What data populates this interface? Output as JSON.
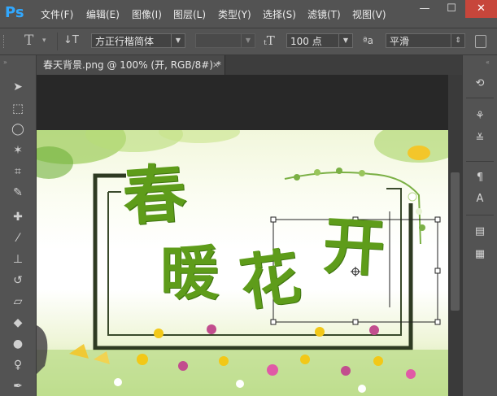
{
  "app": {
    "logo": "Ps"
  },
  "menu": [
    "文件(F)",
    "编辑(E)",
    "图像(I)",
    "图层(L)",
    "类型(Y)",
    "选择(S)",
    "滤镜(T)",
    "视图(V)"
  ],
  "window_controls": {
    "minimize": "—",
    "maximize": "☐",
    "close": "✕"
  },
  "options": {
    "tool_glyph": "T",
    "font_family": "方正行楷简体",
    "font_style": "",
    "font_size": "100 点",
    "aa_label": "ªa",
    "aa_mode": "平滑"
  },
  "document": {
    "tab_title": "春天背景.png @ 100% (开, RGB/8#) *",
    "close": "×"
  },
  "canvas_text": {
    "char1": "春",
    "char2": "暖",
    "char3": "花",
    "char4": "开"
  },
  "tools": [
    "move-tool-icon",
    "marquee-tool-icon",
    "lasso-tool-icon",
    "magic-wand-icon",
    "crop-tool-icon",
    "eyedropper-icon",
    "healing-brush-icon",
    "brush-tool-icon",
    "clone-stamp-icon",
    "history-brush-icon",
    "eraser-icon",
    "paint-bucket-icon",
    "blur-tool-icon",
    "dodge-tool-icon",
    "pen-tool-icon"
  ],
  "colors": {
    "accent": "#31a8ff",
    "text_green": "#5e9c1a",
    "frame": "#2e3a22"
  }
}
